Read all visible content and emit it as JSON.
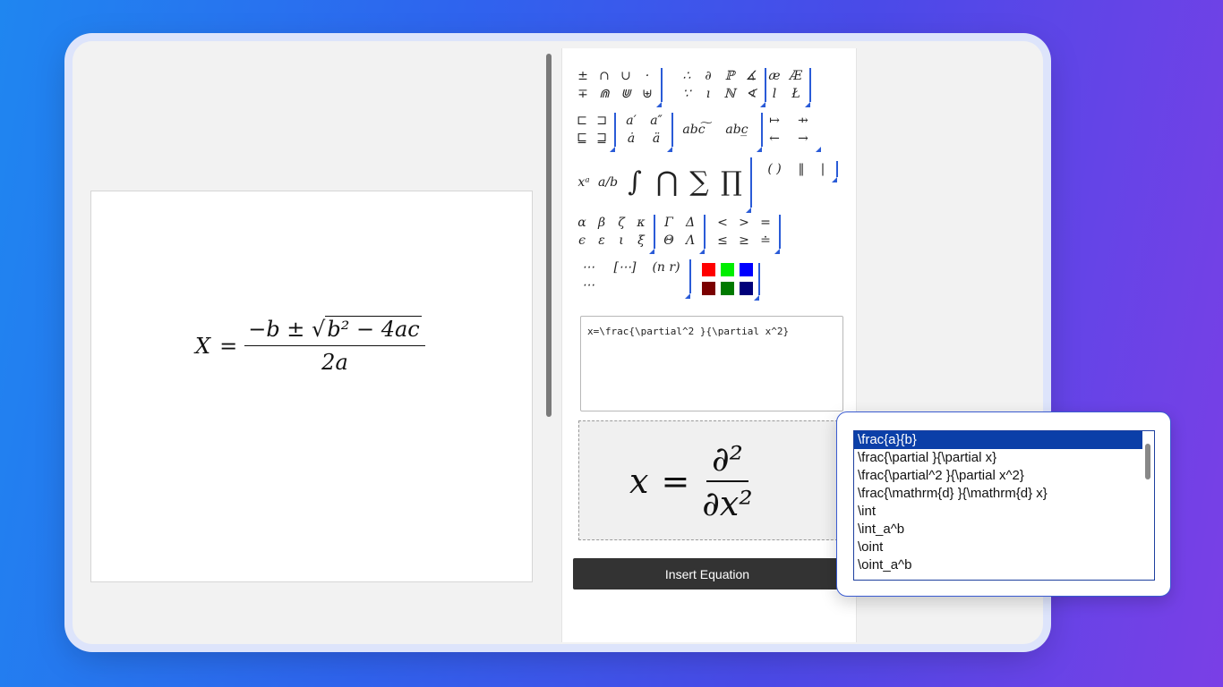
{
  "document": {
    "formula_lhs": "X",
    "formula_eq": "=",
    "formula_num_pre": "−b ± ",
    "formula_num_sqrt": "b² − 4ac",
    "formula_den": "2a"
  },
  "toolbar": {
    "group1": [
      "±",
      "∩",
      "∪",
      "·",
      "∓",
      "⋒",
      "⋓",
      "⊎"
    ],
    "group2": [
      "∴",
      "∂",
      "ℙ",
      "∡",
      "∵",
      "ı",
      "ℕ",
      "∢"
    ],
    "group3": [
      "æ",
      "Æ",
      "l",
      "Ł"
    ],
    "group4": [
      "⊏",
      "⊐",
      "⊑",
      "⊒"
    ],
    "group5": [
      "a′",
      "a″",
      "ȧ",
      "ä"
    ],
    "group6": [
      "abc͠",
      "abc̲"
    ],
    "group7": [
      "↦",
      "⇸",
      "←",
      "→"
    ],
    "group8": [
      "xᵃ",
      "a/b",
      "∫",
      "⋂",
      "∑",
      "∏"
    ],
    "group9": [
      "( )",
      "‖",
      "|"
    ],
    "group10": [
      "α",
      "β",
      "ζ",
      "κ",
      "ϵ",
      "ε",
      "ι",
      "ξ"
    ],
    "group11": [
      "Γ",
      "Δ",
      "Θ",
      "Λ"
    ],
    "group12": [
      "<",
      ">",
      "=",
      "≤",
      "≥",
      "≐"
    ],
    "group13": [
      "⋯",
      "[⋯]",
      "(n r)",
      "⋯"
    ],
    "colors": [
      "#ff0000",
      "#00ee00",
      "#0000ff",
      "#7a0000",
      "#007a00",
      "#00007a"
    ]
  },
  "editor": {
    "value": "x=\\frac{\\partial^2 }{\\partial x^2}"
  },
  "preview": {
    "lhs": "x",
    "eq": "=",
    "num": "∂²",
    "den": "∂x²"
  },
  "insert_button": {
    "label": "Insert Equation"
  },
  "suggestions": {
    "items": [
      "\\frac{a}{b}",
      "\\frac{\\partial }{\\partial x}",
      "\\frac{\\partial^2 }{\\partial x^2}",
      "\\frac{\\mathrm{d} }{\\mathrm{d} x}",
      "\\int",
      "\\int_a^b",
      "\\oint",
      "\\oint_a^b"
    ],
    "selected_index": 0
  }
}
